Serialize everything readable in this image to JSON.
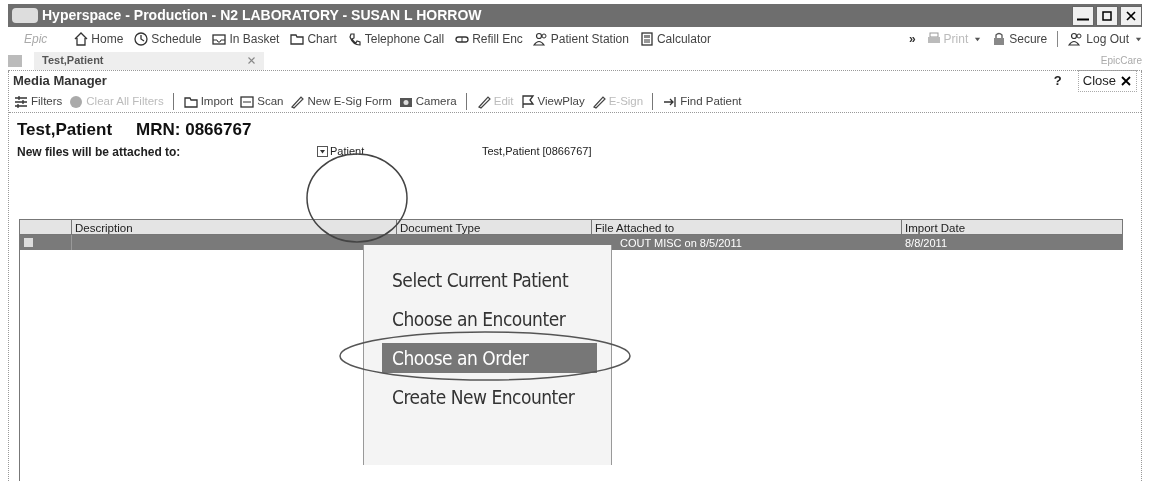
{
  "window": {
    "title": "Hyperspace - Production - N2 LABORATORY - SUSAN L HORROW"
  },
  "main_toolbar": {
    "logo": "Epic",
    "items": [
      {
        "label": "Home"
      },
      {
        "label": "Schedule"
      },
      {
        "label": "In Basket"
      },
      {
        "label": "Chart"
      },
      {
        "label": "Telephone Call"
      },
      {
        "label": "Refill Enc"
      },
      {
        "label": "Patient Station"
      },
      {
        "label": "Calculator"
      }
    ],
    "overflow": "»",
    "right_items": [
      {
        "label": "Print",
        "disabled": true,
        "dropdown": true
      },
      {
        "label": "Secure",
        "disabled": false,
        "dropdown": false
      },
      {
        "label": "Log Out",
        "disabled": false,
        "dropdown": true
      }
    ]
  },
  "tabs": [
    {
      "label": "Test,Patient",
      "selected": true
    }
  ],
  "app_name": "EpicCare",
  "activity": {
    "title": "Media Manager",
    "help": "?",
    "close": "Close"
  },
  "activity_toolbar": [
    {
      "label": "Filters",
      "disabled": false,
      "separator_after": false
    },
    {
      "label": "Clear All Filters",
      "disabled": true,
      "separator_after": true
    },
    {
      "label": "Import",
      "disabled": false,
      "separator_after": false
    },
    {
      "label": "Scan",
      "disabled": false,
      "separator_after": false
    },
    {
      "label": "New E-Sig Form",
      "disabled": false,
      "separator_after": false
    },
    {
      "label": "Camera",
      "disabled": false,
      "separator_after": true
    },
    {
      "label": "Edit",
      "disabled": true,
      "separator_after": false
    },
    {
      "label": "ViewPlay",
      "disabled": false,
      "separator_after": false
    },
    {
      "label": "E-Sign",
      "disabled": true,
      "separator_after": true
    },
    {
      "label": "Find Patient",
      "disabled": false,
      "separator_after": false
    }
  ],
  "patient": {
    "name": "Test,Patient",
    "mrn": "MRN: 0866767",
    "attach_label": "New files will be attached to:",
    "attach_type": "Patient",
    "attach_value": "Test,Patient [0866767]"
  },
  "table": {
    "columns": [
      "Description",
      "Document Type",
      "File Attached to",
      "Import Date"
    ],
    "rows": [
      {
        "selected": true,
        "file_attached_to": "COUT MISC on 8/5/2011",
        "import_date": "8/8/2011"
      }
    ]
  },
  "context_menu": [
    {
      "label": "Select Current Patient",
      "selected": false
    },
    {
      "label": "Choose an Encounter",
      "selected": false
    },
    {
      "label": "Choose an Order",
      "selected": true
    },
    {
      "label": "Create New Encounter",
      "selected": false
    }
  ]
}
